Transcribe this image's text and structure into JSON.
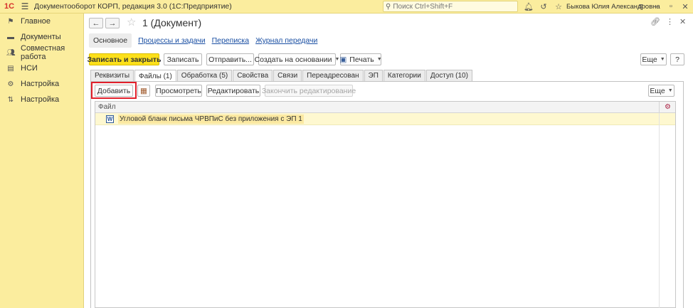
{
  "titlebar": {
    "logo": "1С",
    "app_title": "Документооборот КОРП, редакция 3.0  (1С:Предприятие)",
    "search_placeholder": "Поиск Ctrl+Shift+F",
    "user_name": "Быкова Юлия Александровна"
  },
  "sidebar": {
    "items": [
      {
        "label": "Главное",
        "icon": "flag-icon"
      },
      {
        "label": "Документы",
        "icon": "folder-icon"
      },
      {
        "label": "Совместная работа",
        "icon": "people-icon"
      },
      {
        "label": "НСИ",
        "icon": "book-icon"
      },
      {
        "label": "Настройка",
        "icon": "gear-icon"
      },
      {
        "label": "Настройка",
        "icon": "sliders-icon"
      }
    ]
  },
  "document": {
    "title": "1 (Документ)"
  },
  "subnav": {
    "active": "Основное",
    "links": [
      "Процессы и задачи",
      "Переписка",
      "Журнал передачи"
    ]
  },
  "toolbar": {
    "save_close": "Записать и закрыть",
    "save": "Записать",
    "send": "Отправить...",
    "create_based": "Создать на основании",
    "print": "Печать",
    "more": "Еще",
    "help": "?"
  },
  "tabs": [
    "Реквизиты",
    "Файлы (1)",
    "Обработка (5)",
    "Свойства",
    "Связи",
    "Переадресован",
    "ЭП",
    "Категории",
    "Доступ (10)"
  ],
  "active_tab_index": 1,
  "files_toolbar": {
    "add": "Добавить",
    "view": "Просмотреть",
    "edit": "Редактировать",
    "finish_edit": "Закончить редактирование",
    "more": "Еще"
  },
  "grid": {
    "column": "Файл",
    "rows": [
      {
        "icon": "W",
        "name": "Угловой бланк письма ЧРВПиС без приложения с ЭП 1"
      }
    ]
  },
  "colors": {
    "panel_yellow": "#fbed9e",
    "primary_button": "#fce01a",
    "highlight_red": "#e1202b",
    "link_blue": "#1a4fa3",
    "selected_row": "#fef8d0"
  }
}
